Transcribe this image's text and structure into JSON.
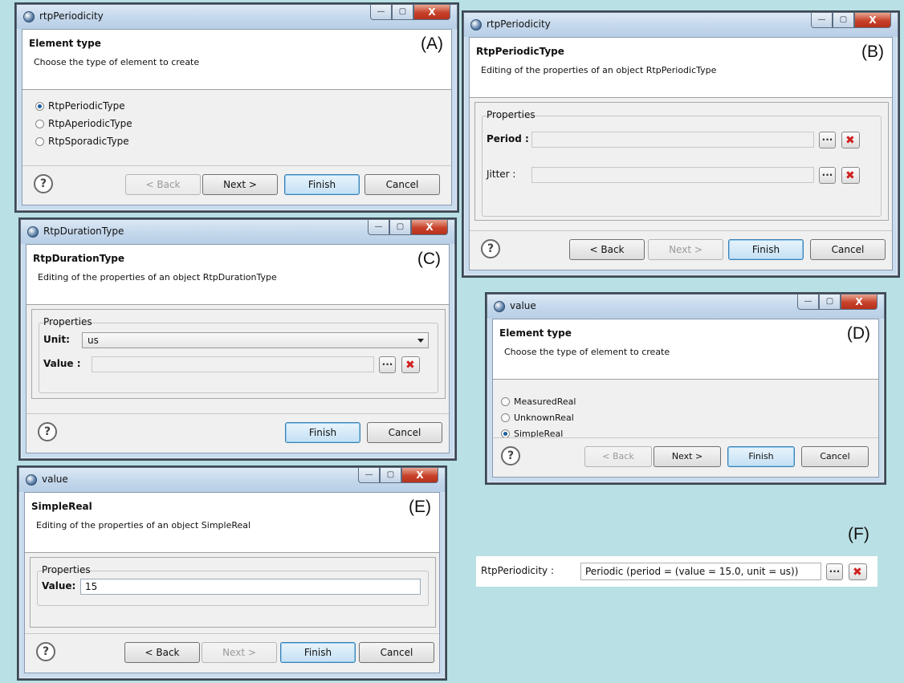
{
  "A": {
    "window_title": "rtpPeriodicity",
    "header_title": "Element type",
    "header_desc": "Choose the type of element to create",
    "panel_label": "(A)",
    "options": [
      {
        "label": "RtpPeriodicType",
        "selected": true
      },
      {
        "label": "RtpAperiodicType",
        "selected": false
      },
      {
        "label": "RtpSporadicType",
        "selected": false
      }
    ],
    "back": "< Back",
    "next": "Next >",
    "finish": "Finish",
    "cancel": "Cancel"
  },
  "B": {
    "window_title": "rtpPeriodicity",
    "header_title": "RtpPeriodicType",
    "header_desc": "Editing of the properties of an object RtpPeriodicType",
    "panel_label": "(B)",
    "group_label": "Properties",
    "period_label": "Period :",
    "jitter_label": "Jitter :",
    "back": "< Back",
    "next": "Next >",
    "finish": "Finish",
    "cancel": "Cancel"
  },
  "C": {
    "window_title": "RtpDurationType",
    "header_title": "RtpDurationType",
    "header_desc": "Editing of the properties of an object RtpDurationType",
    "panel_label": "(C)",
    "group_label": "Properties",
    "unit_label": "Unit:",
    "unit_value": "us",
    "value_label": "Value :",
    "finish": "Finish",
    "cancel": "Cancel"
  },
  "D": {
    "window_title": "value",
    "header_title": "Element type",
    "header_desc": "Choose the type of element to create",
    "panel_label": "(D)",
    "options": [
      {
        "label": "MeasuredReal",
        "selected": false
      },
      {
        "label": "UnknownReal",
        "selected": false
      },
      {
        "label": "SimpleReal",
        "selected": true
      }
    ],
    "back": "< Back",
    "next": "Next >",
    "finish": "Finish",
    "cancel": "Cancel"
  },
  "E": {
    "window_title": "value",
    "header_title": "SimpleReal",
    "header_desc": "Editing of the properties of an object SimpleReal",
    "panel_label": "(E)",
    "group_label": "Properties",
    "value_label": "Value:",
    "value_value": "15",
    "back": "< Back",
    "next": "Next >",
    "finish": "Finish",
    "cancel": "Cancel"
  },
  "F": {
    "panel_label": "(F)",
    "field_label": "RtpPeriodicity :",
    "field_value": "Periodic (period = (value = 15.0, unit = us))"
  },
  "titlebar_buttons": {
    "minimize": "—",
    "maximize": "▢",
    "close": "X"
  },
  "glyphs": {
    "help": "?",
    "ellipsis": "..."
  }
}
